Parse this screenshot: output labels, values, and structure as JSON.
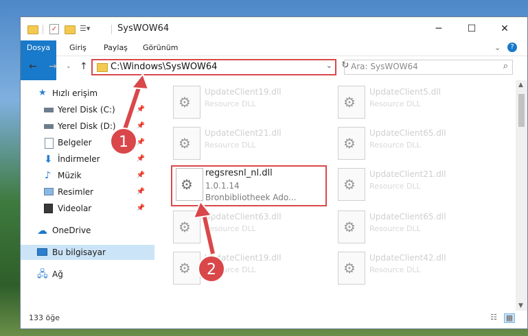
{
  "window": {
    "title": "SysWOW64",
    "controls": {
      "minimize": "─",
      "maximize": "☐",
      "close": "✕"
    }
  },
  "ribbon": {
    "tabs": [
      {
        "label": "Dosya",
        "selected": true
      },
      {
        "label": "Giriş"
      },
      {
        "label": "Paylaş"
      },
      {
        "label": "Görünüm"
      }
    ],
    "expand": "⌄",
    "help": "?"
  },
  "address": {
    "path": "C:\\Windows\\SysWOW64",
    "search_placeholder": "Ara: SysWOW64"
  },
  "nav": {
    "items": [
      {
        "label": "Hızlı erişim",
        "icon": "star-icon"
      },
      {
        "label": "Yerel Disk (C:)",
        "icon": "drive-icon",
        "pinned": true
      },
      {
        "label": "Yerel Disk (D:)",
        "icon": "drive-icon",
        "pinned": true
      },
      {
        "label": "Belgeler",
        "icon": "documents-icon",
        "pinned": true
      },
      {
        "label": "İndirmeler",
        "icon": "download-icon",
        "pinned": true
      },
      {
        "label": "Müzik",
        "icon": "music-icon",
        "pinned": true
      },
      {
        "label": "Resimler",
        "icon": "pictures-icon",
        "pinned": true
      },
      {
        "label": "Videolar",
        "icon": "videos-icon",
        "pinned": true
      },
      {
        "label": "OneDrive",
        "icon": "cloud-icon"
      },
      {
        "label": "Bu bilgisayar",
        "icon": "computer-icon",
        "selected": true
      },
      {
        "label": "Ağ",
        "icon": "network-icon"
      }
    ]
  },
  "files": [
    {
      "name": "UpdateClient19.dll",
      "sub": "Resource DLL"
    },
    {
      "name": "UpdateClient5.dll",
      "sub": "Resource DLL"
    },
    {
      "name": "UpdateClient21.dll",
      "sub": "Resource DLL"
    },
    {
      "name": "UpdateClient65.dll",
      "sub": "Resource DLL"
    },
    {
      "name": "regsresnl_nl.dll",
      "sub": "1.0.1.14",
      "sub2": "Bronbibliotheek Ado...",
      "focused": true
    },
    {
      "name": "UpdateClient21.dll",
      "sub": "Resource DLL"
    },
    {
      "name": "UpdateClient63.dll",
      "sub": "Resource DLL"
    },
    {
      "name": "UpdateClient65.dll",
      "sub": "Resource DLL"
    },
    {
      "name": "UpdateClient19.dll",
      "sub": "Resource DLL"
    },
    {
      "name": "UpdateClient42.dll",
      "sub": "Resource DLL"
    }
  ],
  "status": {
    "count": "133 öğe"
  },
  "callouts": [
    "1",
    "2"
  ],
  "colors": {
    "accent": "#1979ca",
    "highlight": "#d9474a",
    "selection": "#cce4f7"
  }
}
